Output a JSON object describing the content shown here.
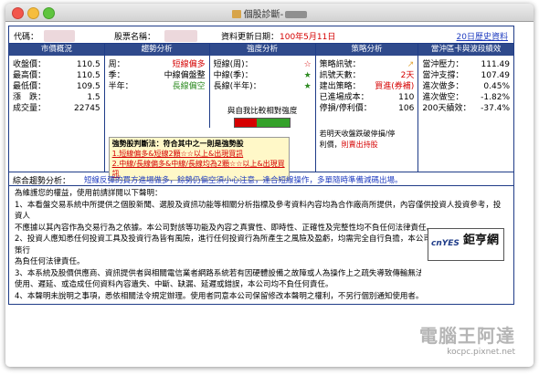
{
  "window": {
    "title": "個股診斷-"
  },
  "header": {
    "code_label": "代碼：",
    "name_label": "股票名稱：",
    "update_label": "資料更新日期：",
    "update_value": "100年5月11日",
    "history_link": "20日歷史資料"
  },
  "market": {
    "title": "市價概況",
    "rows": [
      {
        "k": "收盤價：",
        "v": "110.5"
      },
      {
        "k": "最高價：",
        "v": "110.5"
      },
      {
        "k": "最低價：",
        "v": "109.5"
      },
      {
        "k": "漲　跌：",
        "v": "1.5"
      },
      {
        "k": "成交量：",
        "v": "22745"
      }
    ]
  },
  "trend": {
    "title": "趨勢分析",
    "rows": [
      {
        "k": "周：",
        "v": "短線偏多",
        "color": "#d50000"
      },
      {
        "k": "季：",
        "v": "中線偏盤整",
        "color": "#000000"
      },
      {
        "k": "半年：",
        "v": "長線偏空",
        "color": "#2e8b22"
      }
    ]
  },
  "strength": {
    "title": "強度分析",
    "rows": [
      {
        "k": "短線(周)：",
        "icon": "star-hollow-red"
      },
      {
        "k": "中線(季)：",
        "icon": "star-filled-green"
      },
      {
        "k": "長線(半年)：",
        "icon": "star-filled-green"
      }
    ],
    "relative_label": "與自我比較相對強度"
  },
  "strategy": {
    "title": "策略分析",
    "rows": [
      {
        "k": "策略訊號：",
        "v": ""
      },
      {
        "k": "訊號天數：",
        "v": "2天"
      },
      {
        "k": "建出策略：",
        "v": "買進(券補)"
      },
      {
        "k": "已進場成本：",
        "v": "110"
      },
      {
        "k": "停損/停利價：",
        "v": "106"
      }
    ],
    "note1": "若明天收盤跌破停損/停",
    "note2": "利價，",
    "note2_red": "則賣出持股"
  },
  "volatility": {
    "title": "當沖區卡與波段績效",
    "rows": [
      {
        "k": "當沖壓力：",
        "v": "111.49"
      },
      {
        "k": "當沖支撐：",
        "v": "107.49"
      },
      {
        "k": "進次做多：",
        "v": "0.45%"
      },
      {
        "k": "進次做空：",
        "v": "-1.82%"
      },
      {
        "k": "200天績效：",
        "v": "-37.4%"
      }
    ]
  },
  "legend": {
    "title": "強勢股判斷法：符合其中之一則是強勢股",
    "line1": "1.短線偏多&短線2顆☆☆以上&出現買訊",
    "line2": "2.中線/長線偏多&中線/長線均為2顆☆☆以上&出現買訊"
  },
  "overview": {
    "label": "綜合趨勢分析：",
    "text": "短線反彈的買方進場做多，餘勢仍偏空須小心注意，逢合短線操作，多單隨時準備減碼出場。"
  },
  "disclaimer": {
    "lines": [
      "為維護您的權益，使用前請詳閱以下聲明：",
      "1、本看盤交易系統中所提供之個股新聞、選股及資訊功能等相關分析指標及參考資料內容均為合作廠商所提供，內容僅供投資人投資參考，投資人",
      "不應據以其內容作為交易行為之依據。本公司對該等功能及內容之真實性、即時性、正確性及完整性均不負任何法律責任。",
      "2、投資人應知悉任何投資工具及投資行為皆有風險，進行任何投資行為所產生之風險及盈虧，均需完全自行負擔，本公司不對投資人之投資決策行",
      "為負任何法律責任。",
      "3、本系統及股價供應商、資訊提供者與相關電信業者網路系統若有因硬體設備之故障或人為操作上之疏失導致傳輸無法",
      "使用、遲延、或造成任何資料內容遺失、中斷、缺漏、延遲或錯誤，本公司均不負任何責任。",
      "4、本聲明未說明之事項，悉依相關法令規定辦理。使用者同意本公司保留修改本聲明之權利，不另行個別通知使用者。"
    ]
  },
  "logo": {
    "text1": "cnYES",
    "text2": "鉅亨網"
  },
  "watermark": {
    "text": "電腦王阿達",
    "url": "kocpc.pixnet.net"
  }
}
